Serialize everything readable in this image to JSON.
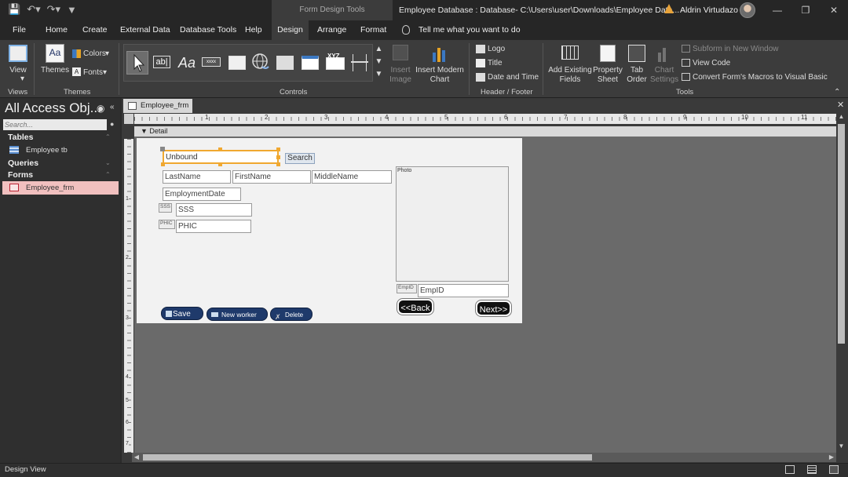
{
  "titlebar": {
    "context_tab": "Form Design Tools",
    "document_title": "Employee Database : Database- C:\\Users\\user\\Downloads\\Employee Data...",
    "user_name": "Aldrin Virtudazo"
  },
  "tabs": [
    {
      "label": "File"
    },
    {
      "label": "Home"
    },
    {
      "label": "Create"
    },
    {
      "label": "External Data"
    },
    {
      "label": "Database Tools"
    },
    {
      "label": "Help"
    },
    {
      "label": "Design"
    },
    {
      "label": "Arrange"
    },
    {
      "label": "Format"
    }
  ],
  "tell_me": "Tell me what you want to do",
  "ribbon": {
    "views": {
      "view_label": "View",
      "group": "Views"
    },
    "themes": {
      "themes_label": "Themes",
      "colors_label": "Colors",
      "fonts_label": "Fonts",
      "group": "Themes"
    },
    "controls": {
      "group": "Controls",
      "insert_image": "Insert Image",
      "insert_chart": "Insert Modern Chart",
      "label_icon_text": "xxxx",
      "xyz_text": "XYZ"
    },
    "header_footer": {
      "logo": "Logo",
      "title": "Title",
      "date_time": "Date and Time",
      "group": "Header / Footer"
    },
    "tools": {
      "add_fields": "Add Existing Fields",
      "property_sheet": "Property Sheet",
      "tab_order": "Tab Order",
      "chart_settings": "Chart Settings",
      "subform": "Subform in New Window",
      "view_code": "View Code",
      "convert": "Convert Form's Macros to Visual Basic",
      "group": "Tools"
    }
  },
  "nav": {
    "title": "All Access Obj...",
    "search_placeholder": "Search...",
    "tables_label": "Tables",
    "table_item": "Employee tb",
    "queries_label": "Queries",
    "forms_label": "Forms",
    "form_item": "Employee_frm"
  },
  "document": {
    "tab_label": "Employee_frm",
    "section_label": "Detail",
    "ruler_numbers": [
      "1",
      "2",
      "3",
      "4",
      "5",
      "6",
      "7",
      "8",
      "9",
      "10",
      "11"
    ],
    "ruler_v_numbers": [
      "1",
      "2",
      "3",
      "4",
      "5",
      "6",
      "7"
    ]
  },
  "form": {
    "unbound": "Unbound",
    "search_button": "Search",
    "last_name": "LastName",
    "first_name": "FirstName",
    "middle_name": "MiddleName",
    "employment_date": "EmploymentDate",
    "sss_label": "SSS",
    "sss_field": "SSS",
    "phic_label": "PHIC",
    "phic_field": "PHIC",
    "photo_label": "Photo",
    "empid_label": "EmpID",
    "empid_field": "EmpID",
    "save": "Save",
    "new_worker": "New worker",
    "delete": "Delete",
    "back": "<<Back",
    "next": "Next>>"
  },
  "status": {
    "text": "Design View"
  },
  "colors": {
    "accent_selection": "#f1c0bf",
    "handle_orange": "#f0a830",
    "button_blue": "#1f3a6b"
  }
}
